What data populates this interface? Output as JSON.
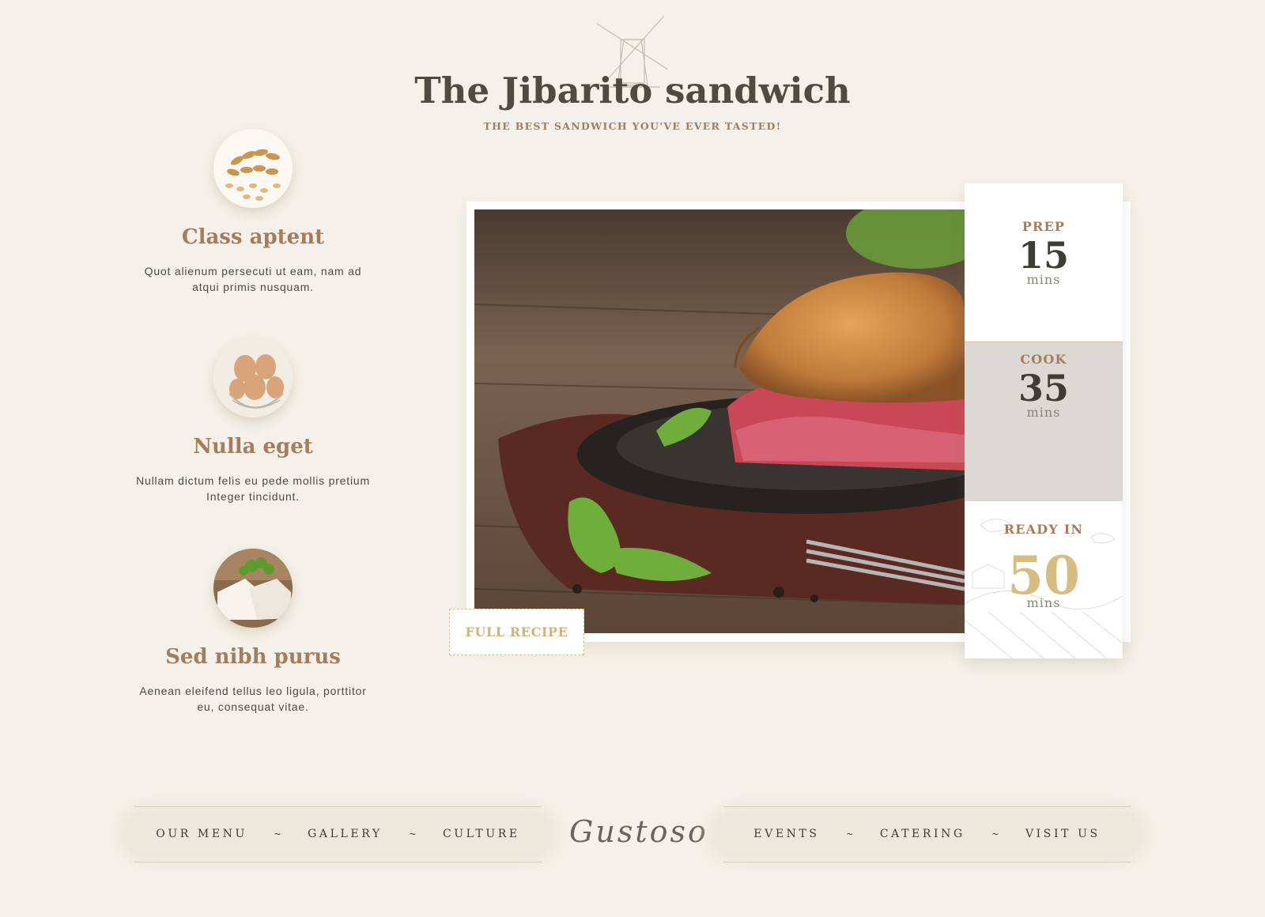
{
  "header": {
    "title": "The Jibarito sandwich",
    "subtitle": "THE BEST SANDWICH YOU'VE EVER TASTED!"
  },
  "features": [
    {
      "title": "Class aptent",
      "text": "Quot alienum persecuti ut eam, nam ad atqui primis nusquam.",
      "icon": "wheat-grains"
    },
    {
      "title": "Nulla eget",
      "text": "Nullam dictum felis eu pede mollis pretium Integer tincidunt.",
      "icon": "eggs-basket"
    },
    {
      "title": "Sed nibh purus",
      "text": "Aenean eleifend tellus leo ligula, porttitor eu, consequat vitae.",
      "icon": "cheese-parsley"
    }
  ],
  "hero": {
    "image": "sandwich-on-plate-photo",
    "button_label": "FULL RECIPE"
  },
  "times": {
    "prep": {
      "label": "PREP",
      "value": "15",
      "unit": "mins"
    },
    "cook": {
      "label": "COOK",
      "value": "35",
      "unit": "mins"
    },
    "ready": {
      "label": "READY IN",
      "value": "50",
      "unit": "mins"
    }
  },
  "nav": {
    "left": [
      "OUR MENU",
      "GALLERY",
      "CULTURE"
    ],
    "right": [
      "EVENTS",
      "CATERING",
      "VISIT US"
    ],
    "separator": "~",
    "brand": "Gustoso"
  },
  "colors": {
    "background": "#f4f1ea",
    "accent_brown": "#a57d5b",
    "accent_gold": "#d4b275",
    "text_dark": "#4f4a42"
  }
}
